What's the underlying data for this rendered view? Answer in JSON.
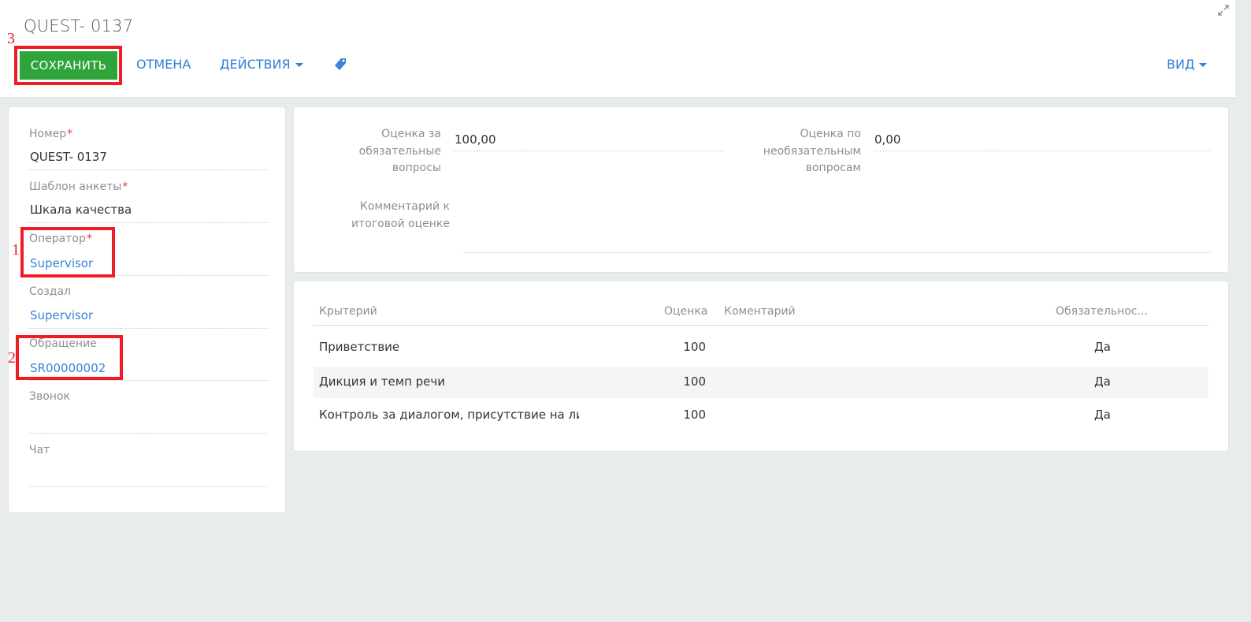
{
  "header": {
    "title": "QUEST- 0137",
    "save_label": "СОХРАНИТЬ",
    "cancel_label": "ОТМЕНА",
    "actions_label": "ДЕЙСТВИЯ",
    "view_label": "ВИД"
  },
  "annotations": [
    "1",
    "2",
    "3"
  ],
  "left_panel": {
    "number": {
      "label": "Номер",
      "value": "QUEST- 0137",
      "required": "*"
    },
    "template": {
      "label": "Шаблон анкеты",
      "value": "Шкала качества",
      "required": "*"
    },
    "operator": {
      "label": "Оператор",
      "value": "Supervisor",
      "required": "*"
    },
    "created_by": {
      "label": "Создал",
      "value": "Supervisor"
    },
    "case": {
      "label": "Обращение",
      "value": "SR00000002"
    },
    "call": {
      "label": "Звонок",
      "value": ""
    },
    "chat": {
      "label": "Чат",
      "value": ""
    }
  },
  "scores": {
    "mandatory_label": [
      "Оценка за",
      "обязательные",
      "вопросы"
    ],
    "mandatory_value": "100,00",
    "optional_label": [
      "Оценка по",
      "необязательным",
      "вопросам"
    ],
    "optional_value": "0,00",
    "comment_label": [
      "Комментарий к",
      "итоговой оценке"
    ],
    "comment_value": ""
  },
  "criteria_table": {
    "columns": [
      "Крытерий",
      "Оценка",
      "Коментарий",
      "Обязательнос..."
    ],
    "rows": [
      {
        "criterion": "Приветствие",
        "score": "100",
        "comment": "",
        "required": "Да"
      },
      {
        "criterion": "Дикция и темп речи",
        "score": "100",
        "comment": "",
        "required": "Да"
      },
      {
        "criterion": "Контроль за диалогом, присутствие на лині",
        "score": "100",
        "comment": "",
        "required": "Да"
      }
    ]
  },
  "colors": {
    "accent": "#2f7fd6",
    "save_button": "#2fa43b",
    "annotation": "#ee1c24",
    "background": "#e9eced"
  },
  "icons": [
    "expand-icon",
    "caret-down-icon",
    "tag-icon"
  ]
}
